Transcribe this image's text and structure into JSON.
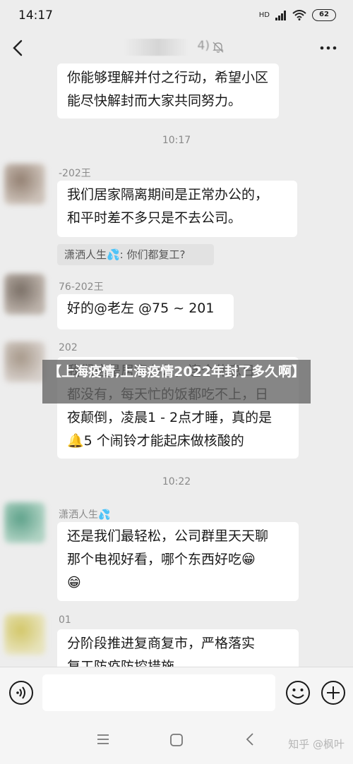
{
  "status_bar": {
    "time": "14:17",
    "network": "HD",
    "battery": "62"
  },
  "top_bar": {
    "title_visible": "4)"
  },
  "messages": {
    "m1": "你能够理解并付之行动，希望小区\n能尽快解封而大家共同努力。",
    "time1": "10:17",
    "m2_sender": "-202王",
    "m2": "我们居家隔离期间是正常办公的，\n和平时差不多只是不去公司。",
    "quote_text": "潇洒人生💦: 你们都复工?",
    "m3_sender": "76-202王",
    "m3": "好的@老左  @75 ~ 201",
    "m4_sender": "202",
    "m4": "我们这是居家办公，连个休息日\n都没有，每天忙的饭都吃不上，日\n夜颠倒，凌晨1 - 2点才睡，真的是\n🔔5 个闹铃才能起床做核酸的",
    "time2": "10:22",
    "m5_sender": "潇洒人生💦",
    "m5": "还是我们最轻松，公司群里天天聊\n那个电视好看，哪个东西好吃😁\n😁",
    "m6_sender": "01",
    "m6": "分阶段推进复商复市，严格落实\n复工防疫防控措施"
  },
  "banner": {
    "text": "【上海疫情,上海疫情2022年封了多久啊】"
  },
  "input_bar": {
    "placeholder": ""
  },
  "watermark": {
    "text": "知乎 @枫叶"
  },
  "colors": {
    "background": "#ededed",
    "bubble": "#ffffff",
    "banner": "#646464"
  }
}
